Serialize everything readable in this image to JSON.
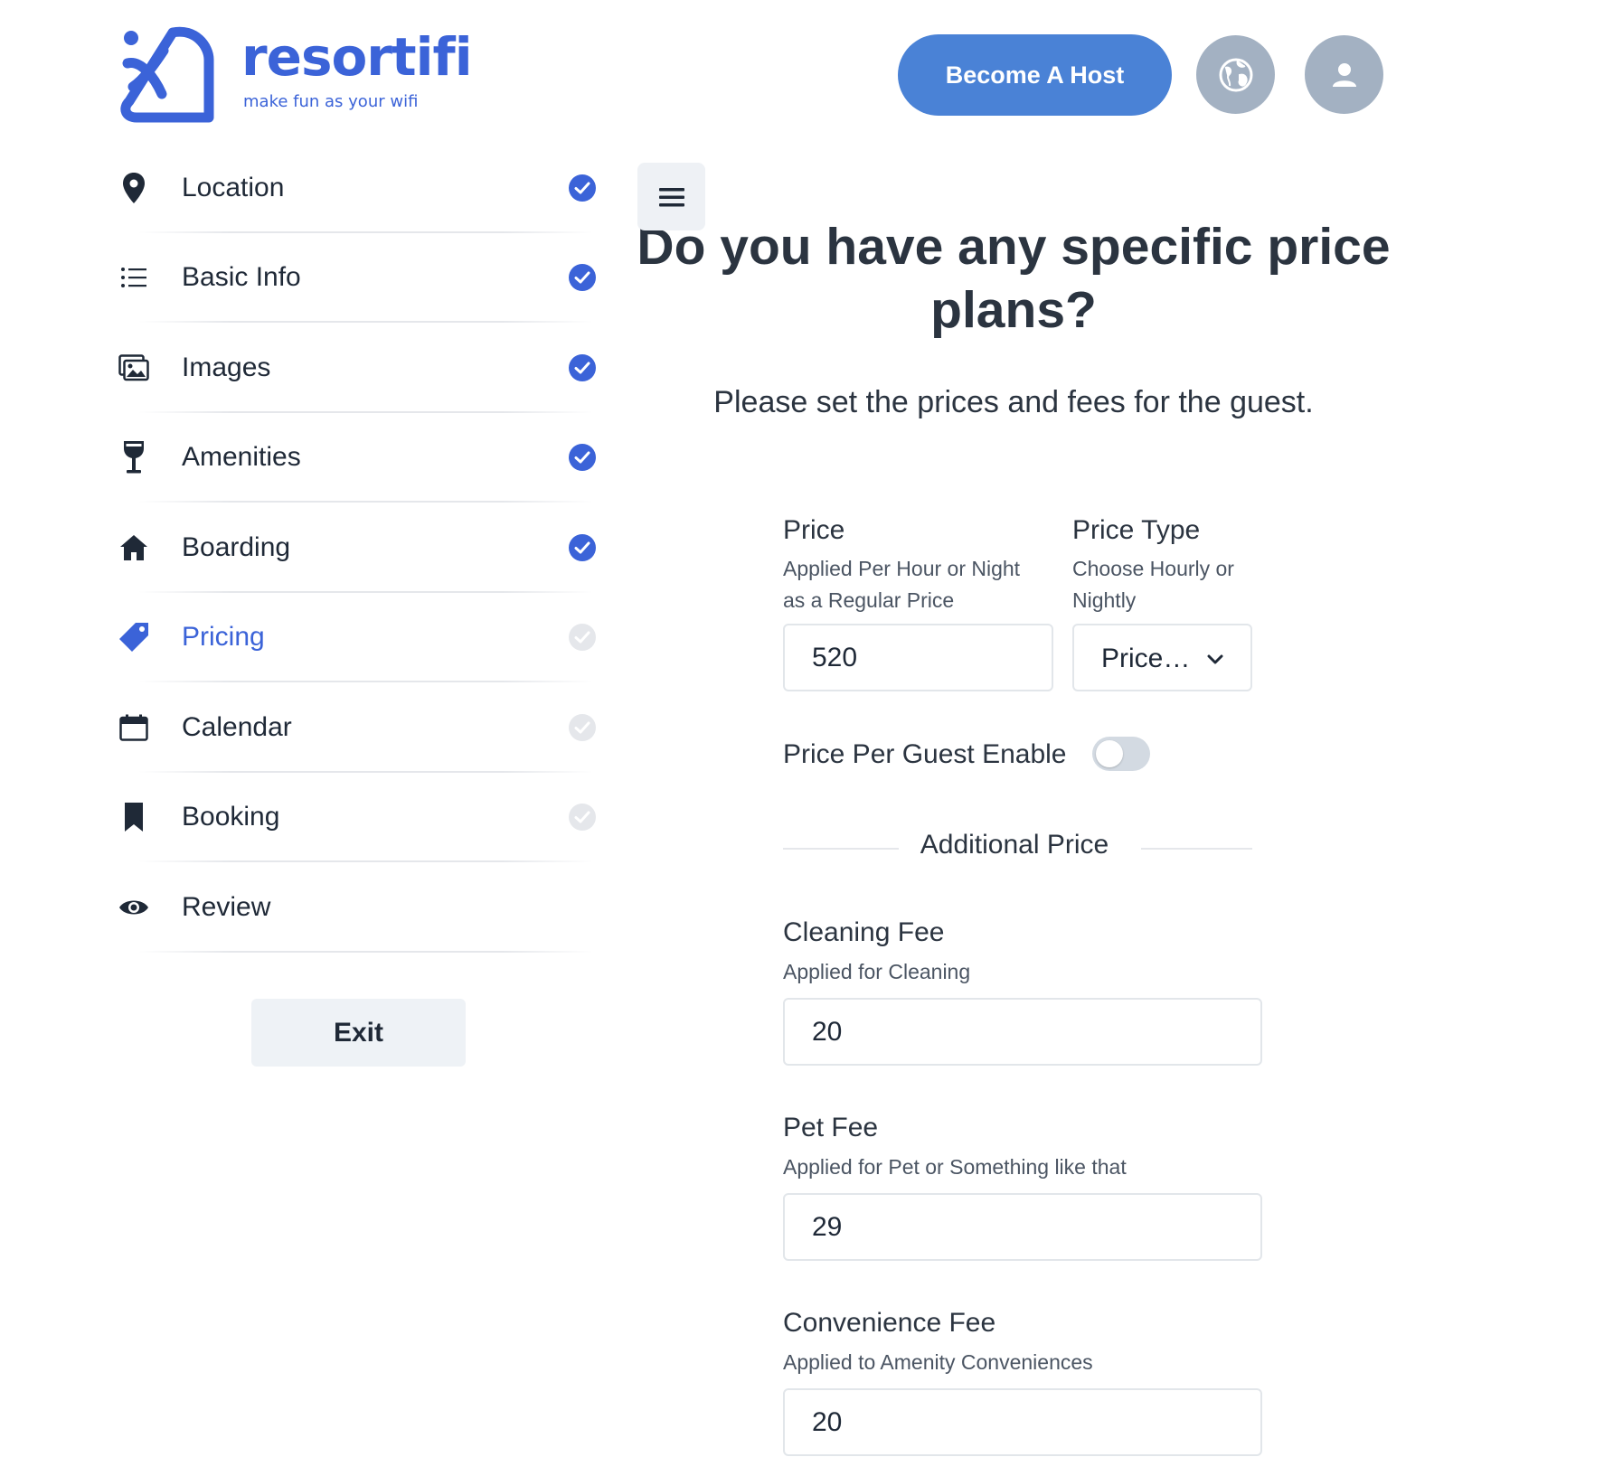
{
  "brand": {
    "name": "resortifi",
    "tagline": "make fun as your wifi",
    "color": "#3b63d8"
  },
  "header": {
    "become_host": "Become A Host",
    "globe_icon": "globe-icon",
    "user_icon": "user-icon"
  },
  "sidebar": {
    "items": [
      {
        "label": "Location",
        "icon": "map-pin-icon",
        "status": "done"
      },
      {
        "label": "Basic Info",
        "icon": "list-icon",
        "status": "done"
      },
      {
        "label": "Images",
        "icon": "images-icon",
        "status": "done"
      },
      {
        "label": "Amenities",
        "icon": "wine-glass-icon",
        "status": "done"
      },
      {
        "label": "Boarding",
        "icon": "home-icon",
        "status": "done"
      },
      {
        "label": "Pricing",
        "icon": "tag-icon",
        "status": "current"
      },
      {
        "label": "Calendar",
        "icon": "calendar-icon",
        "status": "pending"
      },
      {
        "label": "Booking",
        "icon": "bookmark-icon",
        "status": "pending"
      },
      {
        "label": "Review",
        "icon": "eye-icon",
        "status": "none"
      }
    ],
    "exit": "Exit"
  },
  "main": {
    "title": "Do you have any specific price plans?",
    "subtitle": "Please set the prices and fees for the guest.",
    "price": {
      "label": "Price",
      "desc_line1": "Applied Per Hour or Night",
      "desc_line2": "as a Regular Price",
      "value": "520"
    },
    "price_type": {
      "label": "Price Type",
      "desc_line1": "Choose Hourly or",
      "desc_line2": "Nightly",
      "value": "Price…"
    },
    "per_guest": {
      "label": "Price Per Guest Enable",
      "enabled": false
    },
    "additional_heading": "Additional Price",
    "cleaning": {
      "label": "Cleaning Fee",
      "desc": "Applied for Cleaning",
      "value": "20"
    },
    "pet": {
      "label": "Pet Fee",
      "desc": "Applied for Pet or Something like that",
      "value": "29"
    },
    "convenience": {
      "label": "Convenience Fee",
      "desc": "Applied to Amenity Conveniences",
      "value": "20"
    }
  },
  "colors": {
    "accent": "#3b63d8",
    "host_button": "#4a82d6",
    "check_done": "#3b63d8",
    "check_pending": "#e5e7eb"
  }
}
